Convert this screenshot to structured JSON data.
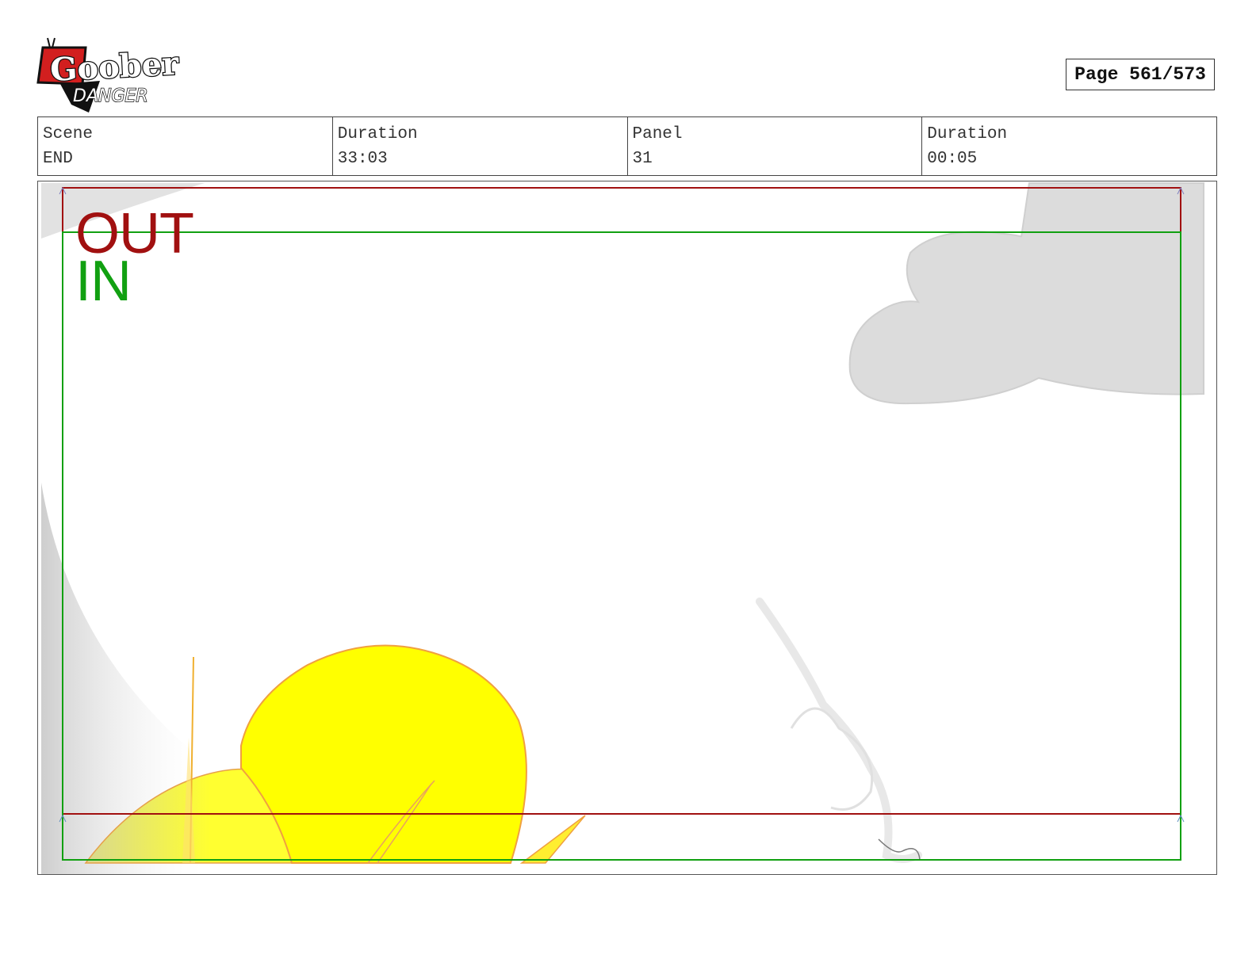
{
  "header": {
    "logo": {
      "line1": "Goober",
      "line2": "DANGER",
      "icon": "tv-antenna-logo"
    },
    "page_label": "Page 561/573"
  },
  "info": {
    "scene": {
      "label": "Scene",
      "value": "END"
    },
    "scene_duration": {
      "label": "Duration",
      "value": "33:03"
    },
    "panel": {
      "label": "Panel",
      "value": "31"
    },
    "panel_duration": {
      "label": "Duration",
      "value": "00:05"
    }
  },
  "frame": {
    "out_label": "OUT",
    "in_label": "IN",
    "colors": {
      "out": "#a11010",
      "in": "#11a011",
      "cloud": "#dcdcdc",
      "sun": "#ffff00",
      "sun_outline": "#f0a040"
    }
  }
}
